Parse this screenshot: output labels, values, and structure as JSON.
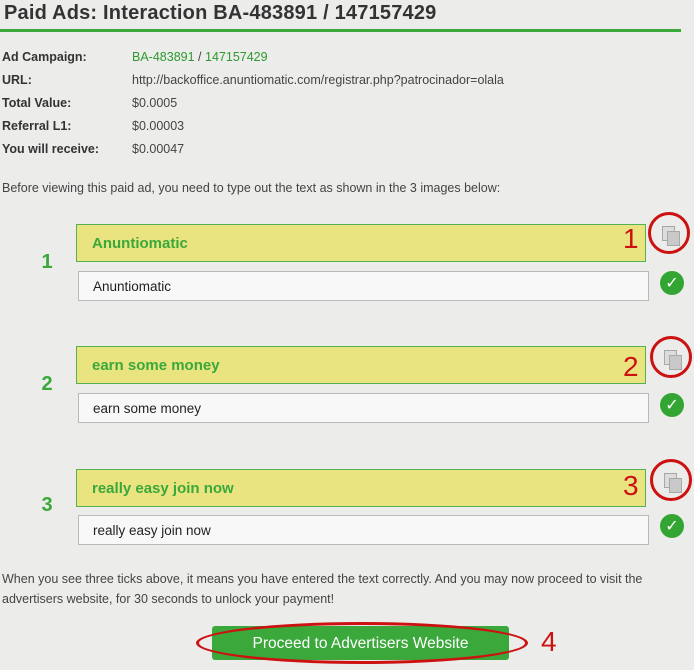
{
  "header": {
    "title": "Paid Ads: Interaction BA-483891 / 147157429"
  },
  "info": {
    "campaign_label": "Ad Campaign:",
    "campaign_id": "BA-483891",
    "campaign_sep": "/",
    "interaction_id": "147157429",
    "url_label": "URL:",
    "url": "http://backoffice.anuntiomatic.com/registrar.php?patrocinador=olala",
    "total_label": "Total Value:",
    "total": "$0.0005",
    "referral_label": "Referral L1:",
    "referral": "$0.00003",
    "receive_label": "You will receive:",
    "receive": "$0.00047"
  },
  "intro": "Before viewing this paid ad, you need to type out the text as shown in the 3 images below:",
  "captchas": [
    {
      "number": "1",
      "image_text": "Anuntiomatic",
      "input_value": "Anuntiomatic",
      "copy_icon": "copy-icon",
      "status_icon": "check-icon",
      "status_glyph": "✓"
    },
    {
      "number": "2",
      "image_text": "earn some money",
      "input_value": "earn some money",
      "copy_icon": "copy-icon",
      "status_icon": "check-icon",
      "status_glyph": "✓"
    },
    {
      "number": "3",
      "image_text": "really easy join now",
      "input_value": "really easy join now",
      "copy_icon": "copy-icon",
      "status_icon": "check-icon",
      "status_glyph": "✓"
    }
  ],
  "annotations": [
    "1",
    "2",
    "3",
    "4"
  ],
  "footer": "When you see three ticks above, it means you have entered the text correctly. And you may now proceed to visit the advertisers website, for 30 seconds to unlock your payment!",
  "proceed_label": "Proceed to Advertisers Website",
  "colors": {
    "accent": "#3aa83a",
    "captcha_bg": "#eae480",
    "annotation": "#cc1111",
    "page_bg": "#ececea"
  }
}
